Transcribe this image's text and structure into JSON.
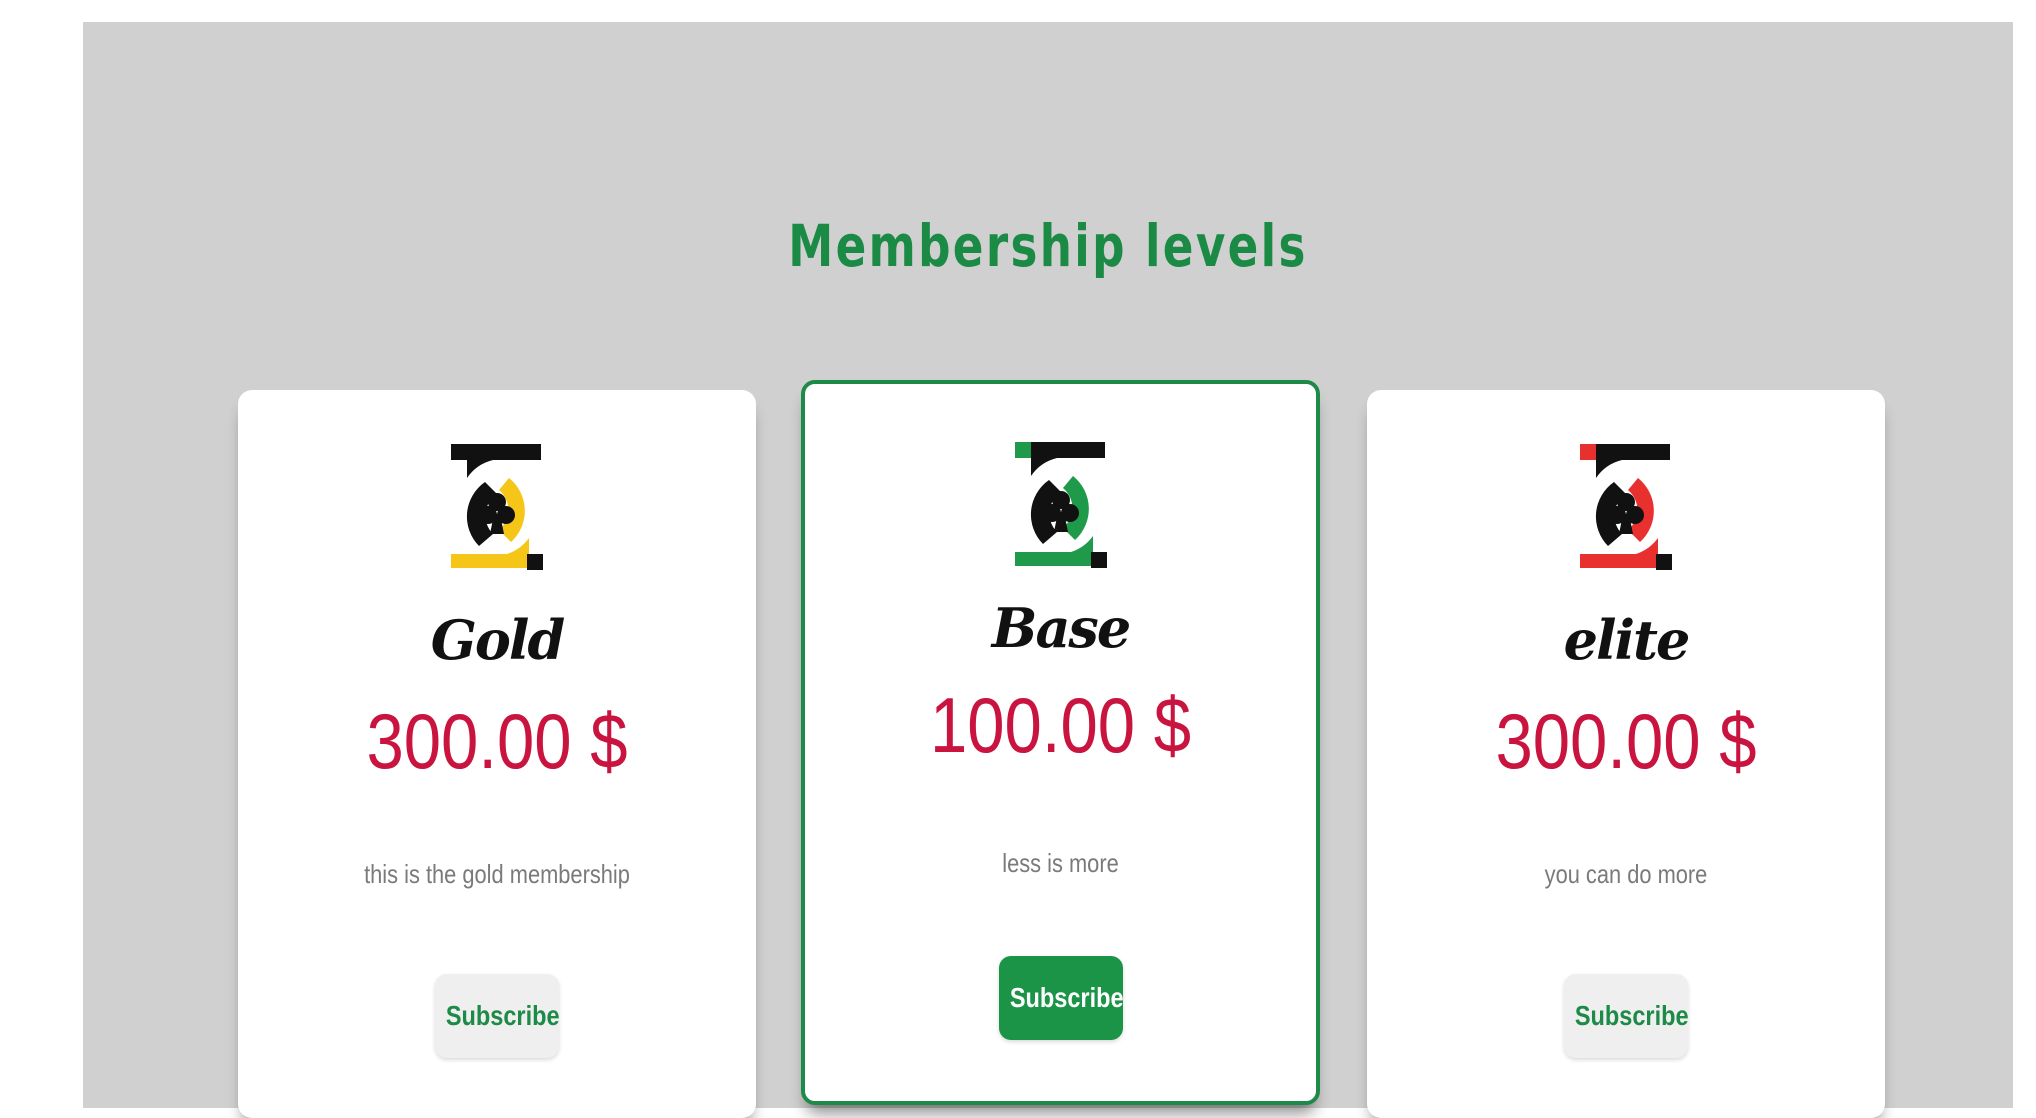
{
  "page": {
    "title": "Membership levels"
  },
  "colors": {
    "title": "#1b8a45",
    "price": "#c8143f",
    "accent_green": "#1e8a47",
    "gold": "#f5c518",
    "green": "#1f9a4a",
    "red": "#e8312f",
    "panel_bg": "#d0d0d0"
  },
  "plans": [
    {
      "name": "Gold",
      "price": "300.00 $",
      "description": "this is the gold membership",
      "button_label": "Subscribe",
      "logo_icon": "club-logo-icon",
      "logo_color": "#f5c518",
      "highlighted": false
    },
    {
      "name": "Base",
      "price": "100.00 $",
      "description": "less is more",
      "button_label": "Subscribe",
      "logo_icon": "club-logo-icon",
      "logo_color": "#1f9a4a",
      "highlighted": true
    },
    {
      "name": "elite",
      "price": "300.00 $",
      "description": "you can do more",
      "button_label": "Subscribe",
      "logo_icon": "club-logo-icon",
      "logo_color": "#e8312f",
      "highlighted": false
    }
  ]
}
